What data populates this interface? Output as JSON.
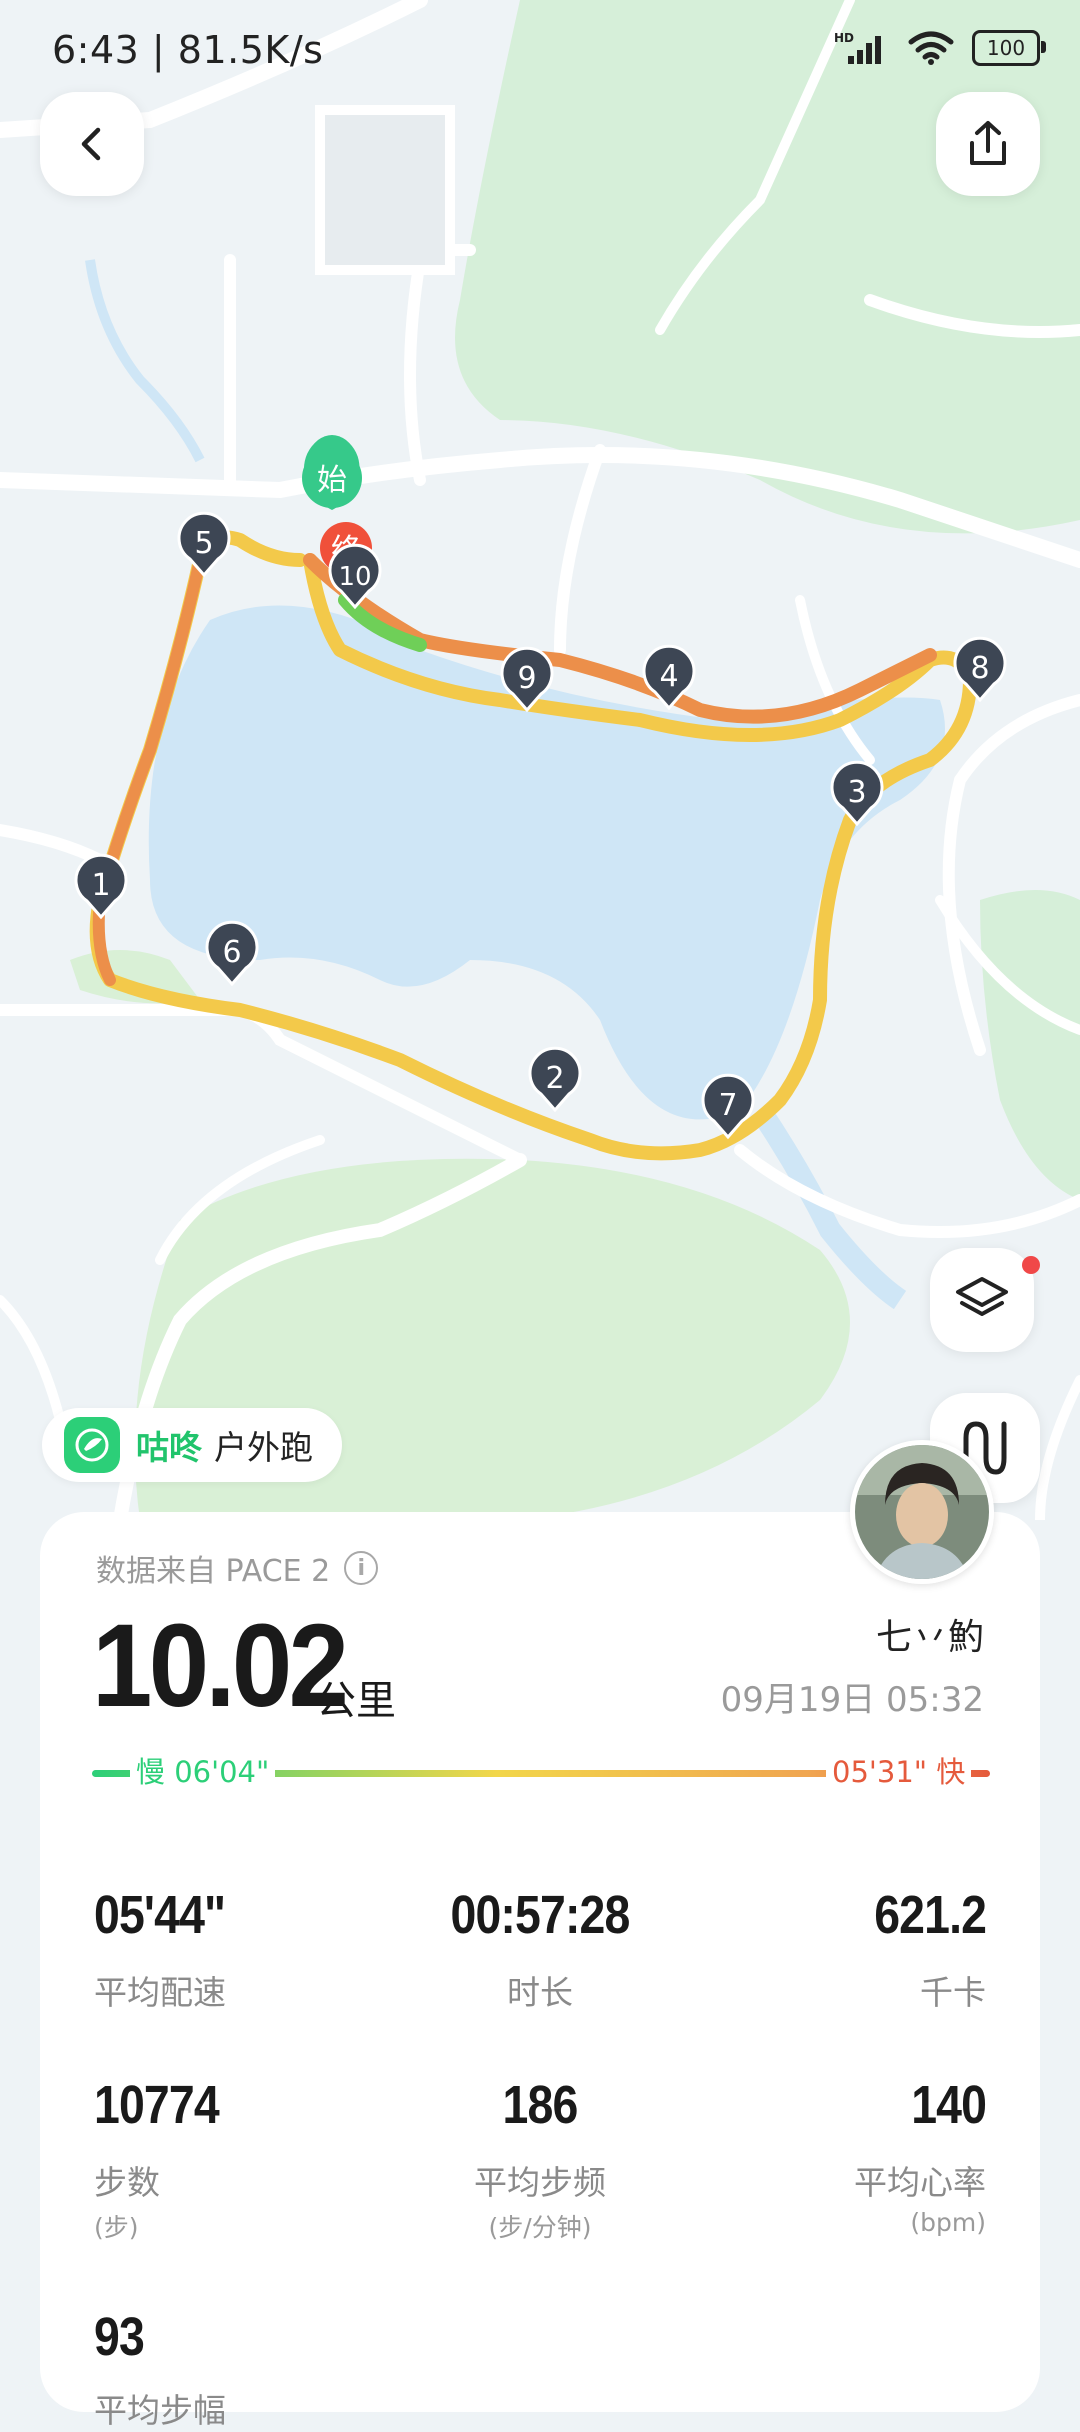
{
  "status": {
    "time": "6:43 | 81.5K/s",
    "battery": "100",
    "network": "HD"
  },
  "map": {
    "start_label": "始",
    "end_label": "终",
    "markers": [
      "1",
      "2",
      "3",
      "4",
      "5",
      "6",
      "7",
      "8",
      "9",
      "10"
    ]
  },
  "brand": {
    "name": "咕咚",
    "activity": "户外跑"
  },
  "summary": {
    "source": "数据来自 PACE 2",
    "distance": "10.02",
    "distance_unit": "公里",
    "username": "七丷魡",
    "datetime": "09月19日 05:32",
    "pace_slow": "慢 06'04\"",
    "pace_fast": "05'31\" 快"
  },
  "stats": [
    {
      "value": "05'44\"",
      "label": "平均配速"
    },
    {
      "value": "00:57:28",
      "label": "时长"
    },
    {
      "value": "621.2",
      "label": "千卡"
    },
    {
      "value": "10774",
      "label": "步数",
      "unit": "(步)"
    },
    {
      "value": "186",
      "label": "平均步频",
      "unit": "(步/分钟)"
    },
    {
      "value": "140",
      "label": "平均心率",
      "unit": "(bpm)"
    },
    {
      "value": "93",
      "label": "平均步幅"
    }
  ],
  "colors": {
    "accent": "#2ccf78",
    "fast": "#e55a3c",
    "route_yellow": "#f3c94a",
    "route_orange": "#ec8f4a",
    "marker": "#3d4654"
  }
}
